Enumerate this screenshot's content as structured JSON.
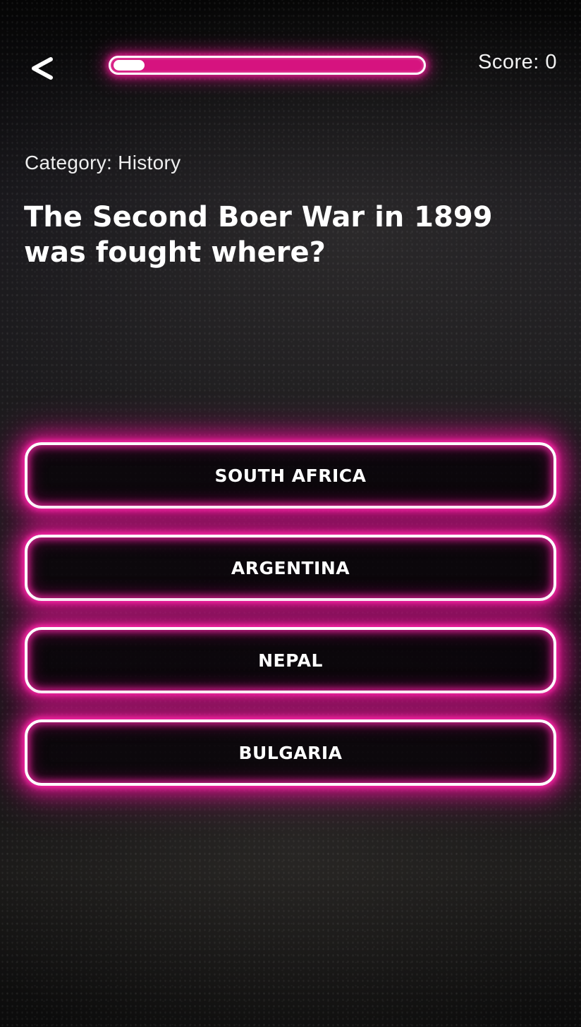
{
  "header": {
    "back_icon": "back-chevron-icon",
    "score_text": "Score: 0",
    "progress_fraction": 0.1
  },
  "quiz": {
    "category_text": "Category: History",
    "question": "The Second Boer War in 1899 was fought where?",
    "answers": [
      {
        "label": "SOUTH AFRICA"
      },
      {
        "label": "ARGENTINA"
      },
      {
        "label": "NEPAL"
      },
      {
        "label": "BULGARIA"
      }
    ]
  },
  "colors": {
    "neon_pink": "#d6137f",
    "text": "#ffffff",
    "background": "#141316"
  }
}
